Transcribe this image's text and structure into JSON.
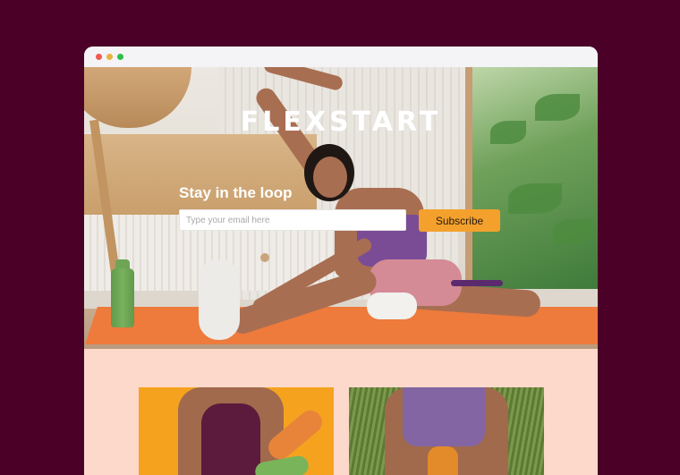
{
  "browser": {
    "dots": [
      "close-dot",
      "minimize-dot",
      "maximize-dot"
    ]
  },
  "hero": {
    "brand": "FLEXSTART",
    "newsletter": {
      "title": "Stay in the loop",
      "email_placeholder": "Type your email here",
      "email_value": "",
      "subscribe_label": "Subscribe"
    }
  },
  "colors": {
    "background": "#4a0027",
    "accent": "#f3a12c",
    "content_bg": "#fdd9cb",
    "mat": "#ee7a3c"
  },
  "products": [
    {
      "card": "product-card-1"
    },
    {
      "card": "product-card-2"
    }
  ]
}
